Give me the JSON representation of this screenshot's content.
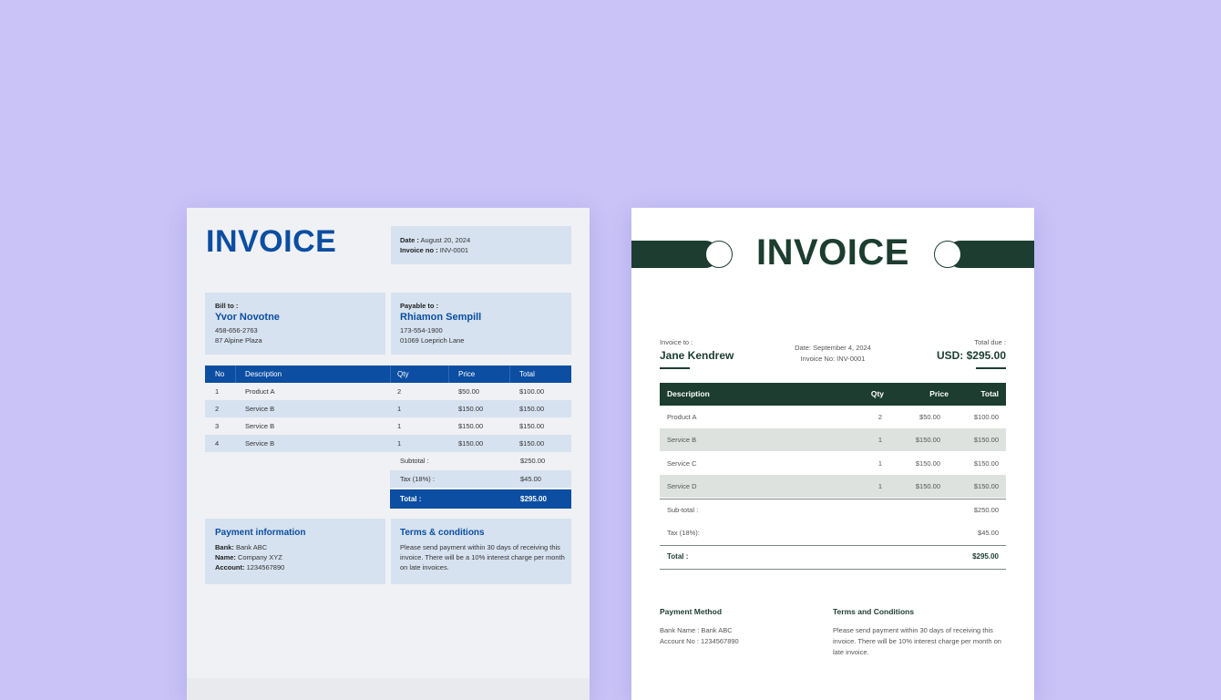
{
  "invoice1": {
    "title": "INVOICE",
    "date_label": "Date :",
    "date_value": "August 20, 2024",
    "invoice_no_label": "Invoice no :",
    "invoice_no_value": "INV-0001",
    "bill_to_label": "Bill to :",
    "bill_to_name": "Yvor Novotne",
    "bill_to_phone": "458-656-2763",
    "bill_to_address": "87 Alpine Plaza",
    "payable_to_label": "Payable to :",
    "payable_to_name": "Rhiamon Sempill",
    "payable_to_phone": "173-554-1900",
    "payable_to_address": "01069 Loeprich Lane",
    "table_headers": [
      "No",
      "Description",
      "Qty",
      "Price",
      "Total"
    ],
    "rows": [
      {
        "no": "1",
        "description": "Product A",
        "qty": "2",
        "price": "$50.00",
        "total": "$100.00"
      },
      {
        "no": "2",
        "description": "Service B",
        "qty": "1",
        "price": "$150.00",
        "total": "$150.00"
      },
      {
        "no": "3",
        "description": "Service B",
        "qty": "1",
        "price": "$150.00",
        "total": "$150.00"
      },
      {
        "no": "4",
        "description": "Service B",
        "qty": "1",
        "price": "$150.00",
        "total": "$150.00"
      }
    ],
    "subtotal_label": "Subtotal :",
    "subtotal_value": "$250.00",
    "tax_label": "Tax (18%) :",
    "tax_value": "$45.00",
    "total_label": "Total :",
    "total_value": "$295.00",
    "payment_title": "Payment information",
    "bank_label": "Bank:",
    "bank_value": "Bank ABC",
    "name_label": "Name:",
    "name_value": "Company XYZ",
    "account_label": "Account:",
    "account_value": "1234567890",
    "terms_title": "Terms & conditions",
    "terms_text": "Please send payment within 30 days of receiving this invoice. There will be a 10% interest charge per month on late invoices.",
    "accent_color": "#0b4ea2"
  },
  "invoice2": {
    "title": "INVOICE",
    "invoice_to_label": "Invoice to :",
    "invoice_to_name": "Jane Kendrew",
    "date_line": "Date: September 4, 2024",
    "invoice_no_line": "Invoice No: INV-0001",
    "total_due_label": "Total due :",
    "total_due_value": "USD: $295.00",
    "table_headers": [
      "Description",
      "Qty",
      "Price",
      "Total"
    ],
    "rows": [
      {
        "description": "Product A",
        "qty": "2",
        "price": "$50.00",
        "total": "$100.00"
      },
      {
        "description": "Service B",
        "qty": "1",
        "price": "$150.00",
        "total": "$150.00"
      },
      {
        "description": "Service C",
        "qty": "1",
        "price": "$150.00",
        "total": "$150.00"
      },
      {
        "description": "Service D",
        "qty": "1",
        "price": "$150.00",
        "total": "$150.00"
      }
    ],
    "subtotal_label": "Sub-total :",
    "subtotal_value": "$250.00",
    "tax_label": "Tax (18%):",
    "tax_value": "$45.00",
    "total_label": "Total :",
    "total_value": "$295.00",
    "payment_title": "Payment Method",
    "bank_line": "Bank Name : Bank ABC",
    "account_line": "Account No : 1234567890",
    "terms_title": "Terms and Conditions",
    "terms_text": "Please send payment within 30 days of receiving this invoice. There will be 10% interest charge per month on late invoice.",
    "accent_color": "#1c3d30"
  },
  "background_color": "#c9c3f8"
}
